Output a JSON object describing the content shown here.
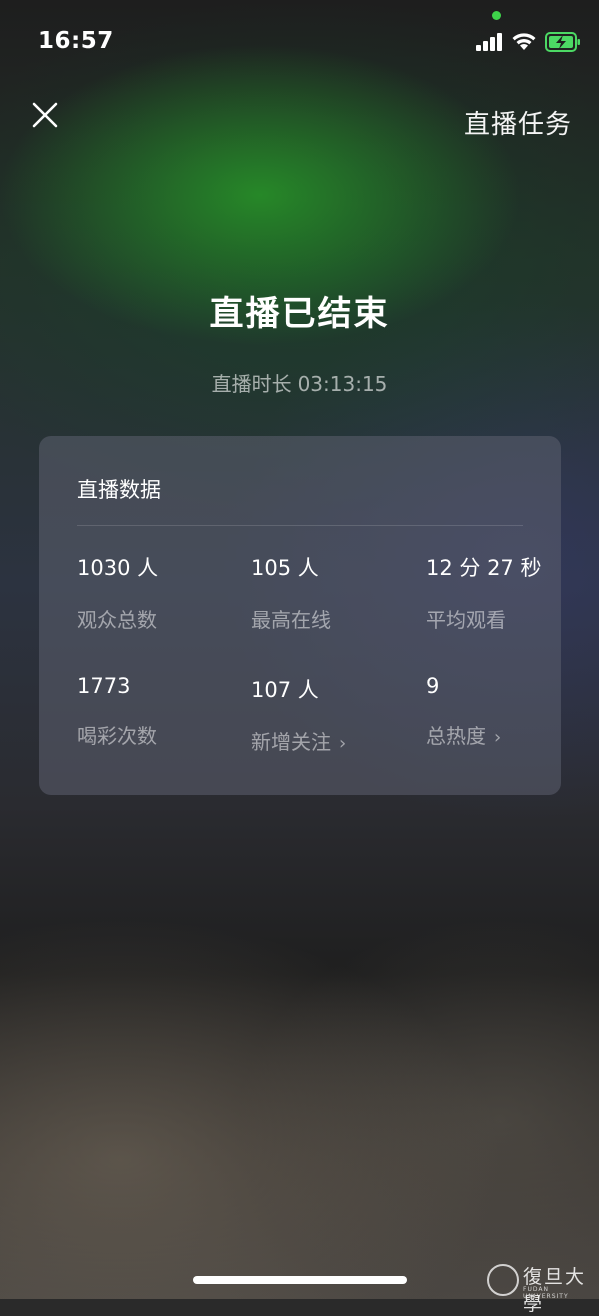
{
  "status_bar": {
    "time": "16:57",
    "icons": [
      "camera-indicator-dot",
      "signal-icon",
      "wifi-icon",
      "battery-charging-icon"
    ],
    "indicator_color": "#3ed34a",
    "battery_color": "#4cd964"
  },
  "header": {
    "close_icon": "close-icon",
    "task_label": "直播任务"
  },
  "main": {
    "title": "直播已结束",
    "duration_label": "直播时长",
    "duration_value": "03:13:15"
  },
  "card": {
    "title": "直播数据",
    "stats": [
      {
        "value": "1030 人",
        "label": "观众总数",
        "has_chevron": false
      },
      {
        "value": "105 人",
        "label": "最高在线",
        "has_chevron": false
      },
      {
        "value": "12 分 27 秒",
        "label": "平均观看",
        "has_chevron": false
      },
      {
        "value": "1773",
        "label": "喝彩次数",
        "has_chevron": false
      },
      {
        "value": "107 人",
        "label": "新增关注",
        "has_chevron": true
      },
      {
        "value": "9",
        "label": "总热度",
        "has_chevron": true
      }
    ],
    "chevron": "›"
  },
  "watermark": {
    "name": "復旦大學",
    "sub": "FUDAN UNIVERSITY"
  }
}
